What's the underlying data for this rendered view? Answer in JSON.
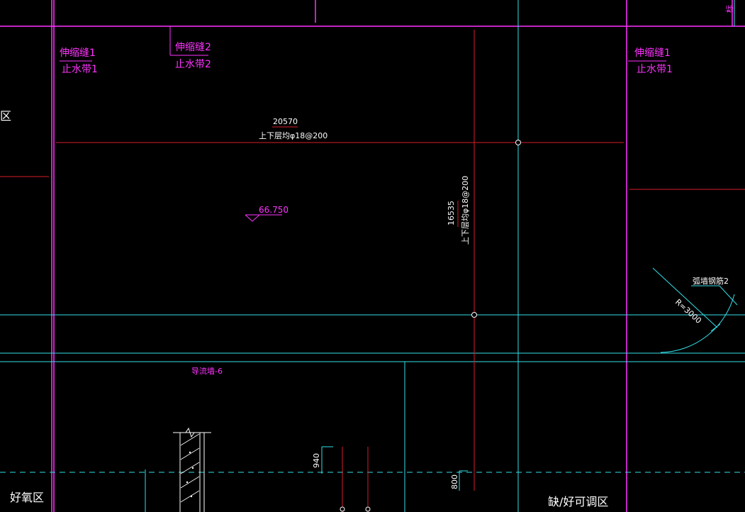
{
  "colors": {
    "background": "#000000",
    "magenta": "#ff33ff",
    "cyan": "#33e0ea",
    "red": "#d81b2a",
    "white": "#ffffff"
  },
  "labels": {
    "joint1_top_left": "伸缩缝1",
    "waterstop1_left": "止水带1",
    "joint2_top": "伸缩缝2",
    "waterstop2": "止水带2",
    "joint1_top_right": "伸缩缝1",
    "waterstop1_right": "止水带1",
    "zone_left_fragment": "区",
    "top_right_fragment": "标",
    "rebar_h_length": "20570",
    "rebar_h_spec": "上下层均φ18@200",
    "elevation": "66.750",
    "rebar_v_length": "16535",
    "rebar_v_spec": "上下层均φ18@200",
    "curved_wall_label": "弧墙钢筋2",
    "radius": "R=3000",
    "deflector_wall": "导流墙-6",
    "dim_940": "940",
    "dim_800": "800",
    "zone_aerobic": "好氧区",
    "zone_anoxic": "缺/好可调区"
  }
}
